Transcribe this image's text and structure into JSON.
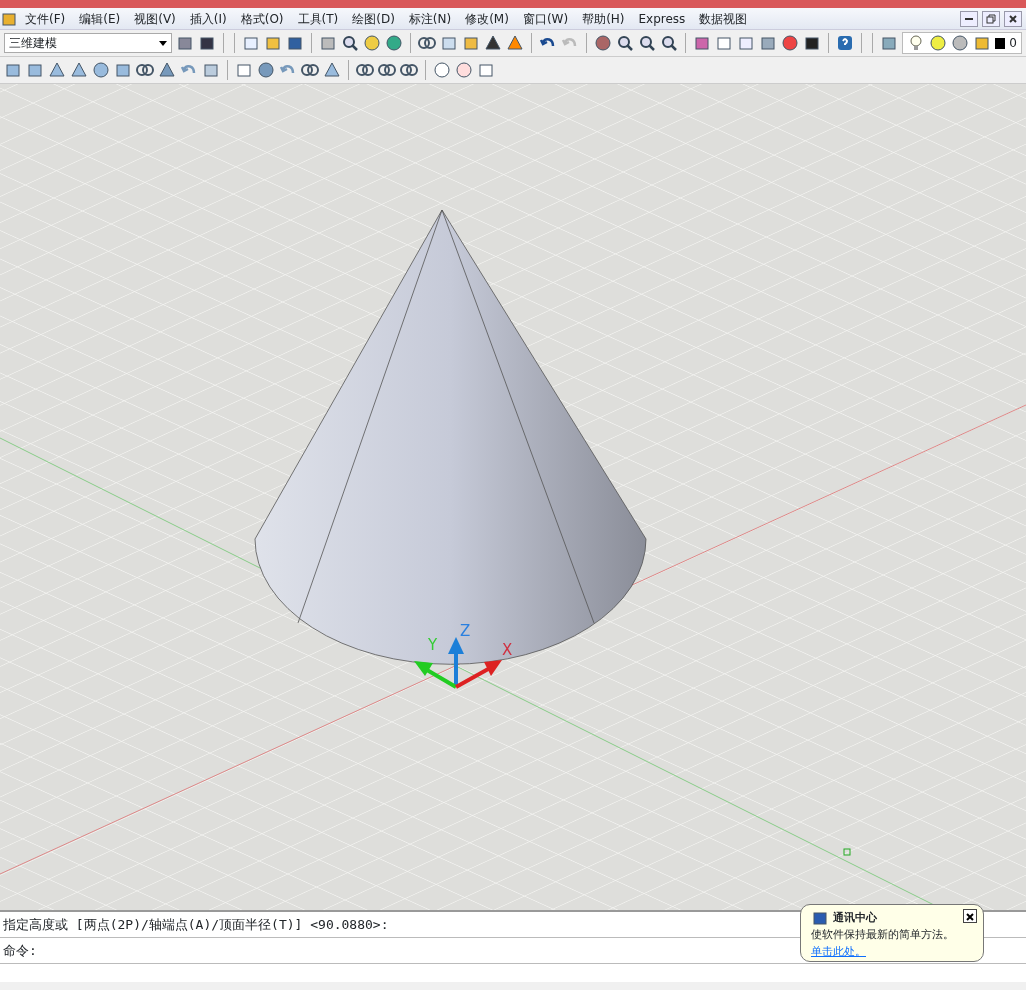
{
  "menu": [
    "文件(F)",
    "编辑(E)",
    "视图(V)",
    "插入(I)",
    "格式(O)",
    "工具(T)",
    "绘图(D)",
    "标注(N)",
    "修改(M)",
    "窗口(W)",
    "帮助(H)",
    "Express",
    "数据视图"
  ],
  "workspace": {
    "value": "三维建模"
  },
  "layer": {
    "value": "0"
  },
  "ucs": {
    "x": "X",
    "y": "Y",
    "z": "Z"
  },
  "command": {
    "history": "指定高度或 [两点(2P)/轴端点(A)/顶面半径(T)] <90.0880>:",
    "prompt": "命令:"
  },
  "balloon": {
    "title": "通讯中心",
    "text": "使软件保持最新的简单方法。",
    "link": "单击此处。"
  }
}
